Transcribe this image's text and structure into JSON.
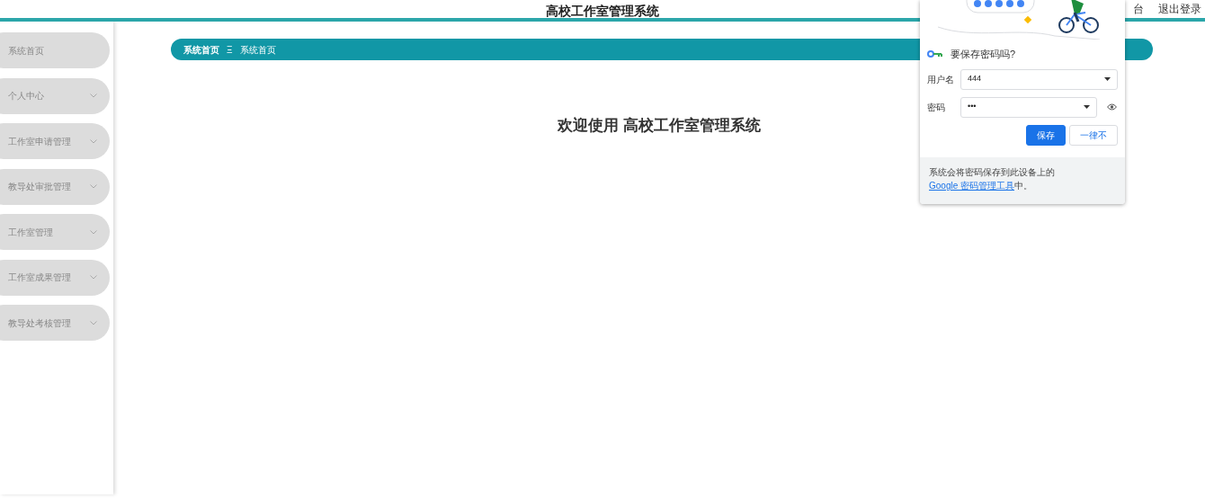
{
  "header": {
    "title": "高校工作室管理系统",
    "links": [
      "台",
      "退出登录"
    ]
  },
  "sidebar": {
    "items": [
      {
        "label": "系统首页",
        "kind": "link"
      },
      {
        "label": "个人中心",
        "kind": "menu"
      },
      {
        "label": "工作室申请管理",
        "kind": "menu"
      },
      {
        "label": "教导处审批管理",
        "kind": "menu"
      },
      {
        "label": "工作室管理",
        "kind": "menu"
      },
      {
        "label": "工作室成果管理",
        "kind": "menu"
      },
      {
        "label": "教导处考核管理",
        "kind": "menu"
      }
    ]
  },
  "breadcrumb": {
    "items": [
      "系统首页",
      "系统首页"
    ],
    "separator": "Ξ"
  },
  "welcome": "欢迎使用 高校工作室管理系统",
  "save_password_popup": {
    "title": "要保存密码吗?",
    "fields": [
      {
        "label": "用户名",
        "value": "444",
        "kind": "username"
      },
      {
        "label": "密码",
        "value": "•••",
        "kind": "password"
      }
    ],
    "buttons": [
      {
        "label": "保存",
        "kind": "primary"
      },
      {
        "label": "一律不",
        "kind": "secondary"
      }
    ],
    "footer": {
      "text_before": "系统会将密码保存到此设备上的 ",
      "link": "Google 密码管理工具",
      "text_after": "中。"
    }
  }
}
